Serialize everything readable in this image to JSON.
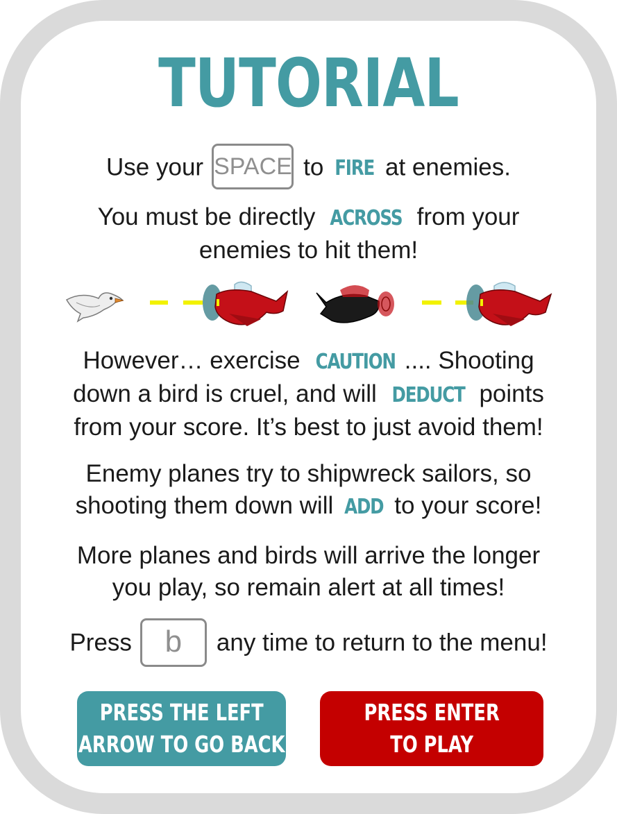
{
  "tutorial": {
    "title": "TUTORIAL",
    "fire_line": {
      "pre": "Use your",
      "key": "SPACE",
      "mid": "to",
      "highlight": "FIRE",
      "post": "at enemies."
    },
    "across_line": {
      "l1_pre": "You must be directly",
      "l1_highlight": "ACROSS",
      "l1_post": "from your",
      "l2": "enemies to hit them!"
    },
    "caution_para": {
      "l1_pre": "However… exercise",
      "l1_highlight": "CAUTION",
      "l1_post": ".... Shooting",
      "l2_pre": "down a bird is cruel, and will",
      "l2_highlight": "DEDUCT",
      "l2_post": "points",
      "l3": "from your score. It’s best to just avoid them!"
    },
    "planes_para": {
      "l1": "Enemy planes try to shipwreck sailors, so",
      "l2_pre": "shooting them down will",
      "l2_highlight": "ADD",
      "l2_post": "to your score!"
    },
    "more_para": {
      "l1": "More planes and birds will arrive the longer",
      "l2": "you play, so remain alert at all times!"
    },
    "menu_line": {
      "pre": "Press",
      "key": "b",
      "post": "any time to return to the menu!"
    }
  },
  "buttons": {
    "back_l1": "PRESS THE LEFT",
    "back_l2": "ARROW TO GO BACK",
    "play_l1": "PRESS ENTER",
    "play_l2": "TO PLAY"
  },
  "colors": {
    "accent": "#449ba3",
    "play": "#c40000",
    "frame": "#dadada",
    "laser": "#f2f200",
    "enemy_plane": "#c41018",
    "player_plane": "#1a1a1a"
  },
  "icons": [
    "seagull-icon",
    "laser-dash-icon",
    "enemy-plane-icon",
    "player-plane-icon"
  ]
}
